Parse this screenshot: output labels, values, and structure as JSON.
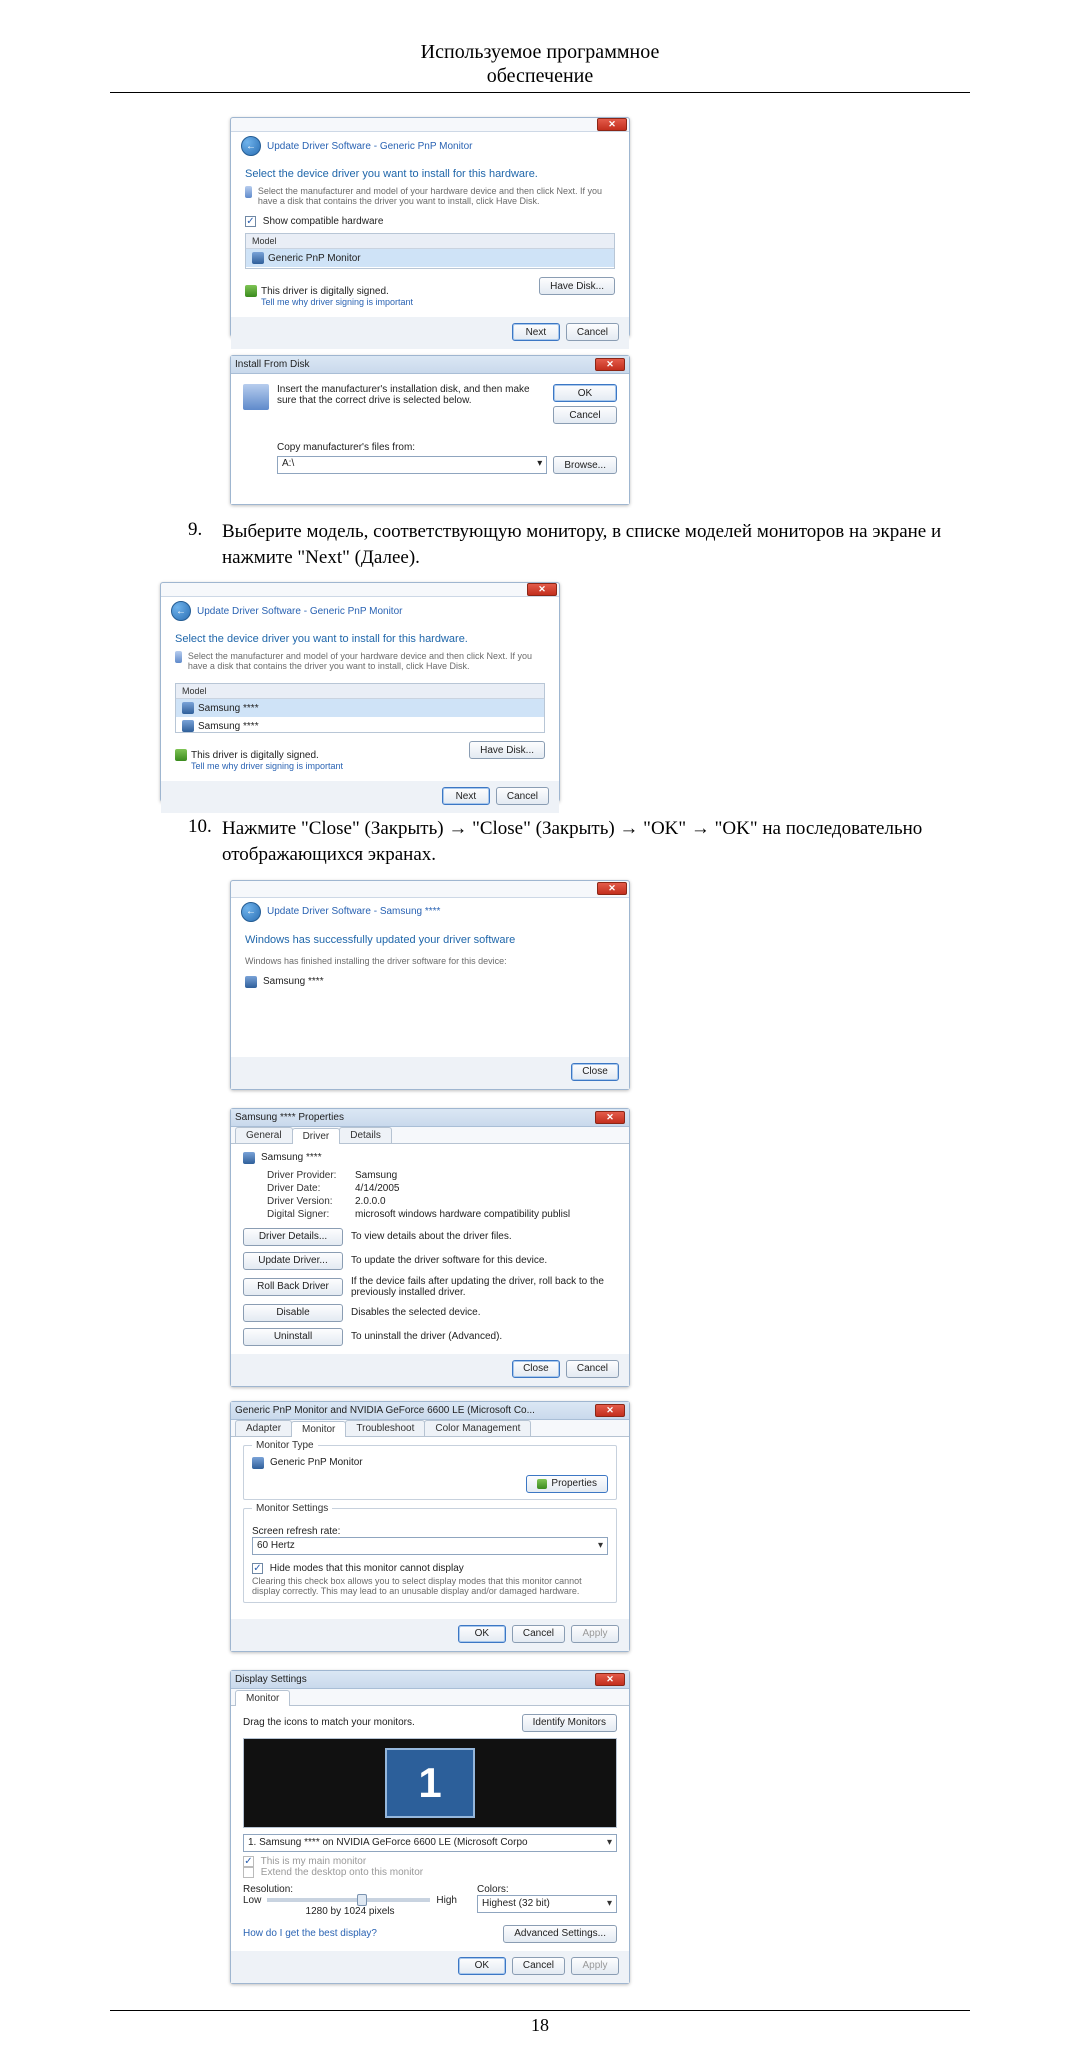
{
  "header": {
    "line1": "Используемое программное",
    "line2": "обеспечение"
  },
  "steps": {
    "s9": {
      "n": "9.",
      "text": "Выберите модель, соответствующую монитору, в списке моделей мониторов на экране и нажмите \"Next\" (Далее)."
    },
    "s10": {
      "n": "10.",
      "text": "Нажмите \"Close\" (Закрыть) → \"Close\" (Закрыть) → \"ОK\" → \"ОK\" на последовательно отображающихся экранах."
    }
  },
  "driver_picker": {
    "title": "Update Driver Software - Generic PnP Monitor",
    "instr": "Select the device driver you want to install for this hardware.",
    "note": "Select the manufacturer and model of your hardware device and then click Next. If you have a disk that contains the driver you want to install, click Have Disk.",
    "show_compat": "Show compatible hardware",
    "list_header": "Model",
    "item": "Generic PnP Monitor",
    "signed": "This driver is digitally signed.",
    "signed_link": "Tell me why driver signing is important",
    "have_disk": "Have Disk...",
    "next": "Next",
    "cancel": "Cancel"
  },
  "install_disk": {
    "title": "Install From Disk",
    "msg": "Insert the manufacturer's installation disk, and then make sure that the correct drive is selected below.",
    "ok": "OK",
    "cancel": "Cancel",
    "copy_from": "Copy manufacturer's files from:",
    "drive": "A:\\",
    "browse": "Browse..."
  },
  "driver_picker2": {
    "title": "Update Driver Software - Generic PnP Monitor",
    "instr": "Select the device driver you want to install for this hardware.",
    "note": "Select the manufacturer and model of your hardware device and then click Next. If you have a disk that contains the driver you want to install, click Have Disk.",
    "list_header": "Model",
    "item1": "Samsung ****",
    "item2": "Samsung ****",
    "signed": "This driver is digitally signed.",
    "signed_link": "Tell me why driver signing is important",
    "have_disk": "Have Disk...",
    "next": "Next",
    "cancel": "Cancel"
  },
  "finish": {
    "title": "Update Driver Software - Samsung ****",
    "headline": "Windows has successfully updated your driver software",
    "sub": "Windows has finished installing the driver software for this device:",
    "device": "Samsung ****",
    "close": "Close"
  },
  "props": {
    "title": "Samsung **** Properties",
    "tab_general": "General",
    "tab_driver": "Driver",
    "tab_details": "Details",
    "device": "Samsung ****",
    "provider_k": "Driver Provider:",
    "provider_v": "Samsung",
    "date_k": "Driver Date:",
    "date_v": "4/14/2005",
    "ver_k": "Driver Version:",
    "ver_v": "2.0.0.0",
    "signer_k": "Digital Signer:",
    "signer_v": "microsoft windows hardware compatibility publisl",
    "details_btn": "Driver Details...",
    "details_txt": "To view details about the driver files.",
    "update_btn": "Update Driver...",
    "update_txt": "To update the driver software for this device.",
    "rollback_btn": "Roll Back Driver",
    "rollback_txt": "If the device fails after updating the driver, roll back to the previously installed driver.",
    "disable_btn": "Disable",
    "disable_txt": "Disables the selected device.",
    "uninstall_btn": "Uninstall",
    "uninstall_txt": "To uninstall the driver (Advanced).",
    "close": "Close",
    "cancel": "Cancel"
  },
  "mon_props": {
    "title": "Generic PnP Monitor and NVIDIA GeForce 6600 LE (Microsoft Co...",
    "tab_adapter": "Adapter",
    "tab_monitor": "Monitor",
    "tab_trouble": "Troubleshoot",
    "tab_color": "Color Management",
    "mtype_title": "Monitor Type",
    "mtype_value": "Generic PnP Monitor",
    "properties": "Properties",
    "msettings_title": "Monitor Settings",
    "refresh_label": "Screen refresh rate:",
    "refresh_value": "60 Hertz",
    "hide_check": "Hide modes that this monitor cannot display",
    "hide_note": "Clearing this check box allows you to select display modes that this monitor cannot display correctly. This may lead to an unusable display and/or damaged hardware.",
    "ok": "OK",
    "cancel": "Cancel",
    "apply": "Apply"
  },
  "display": {
    "title": "Display Settings",
    "tab_monitor": "Monitor",
    "drag": "Drag the icons to match your monitors.",
    "identify": "Identify Monitors",
    "big1": "1",
    "sel_label": "1. Samsung **** on NVIDIA GeForce 6600 LE (Microsoft Corpo",
    "main_check": "This is my main monitor",
    "extend_check": "Extend the desktop onto this monitor",
    "res_label": "Resolution:",
    "low": "Low",
    "high": "High",
    "res_value": "1280 by 1024 pixels",
    "colors_label": "Colors:",
    "colors_value": "Highest (32 bit)",
    "best_link": "How do I get the best display?",
    "advanced": "Advanced Settings...",
    "ok": "OK",
    "cancel": "Cancel",
    "apply": "Apply"
  },
  "page_number": "18"
}
